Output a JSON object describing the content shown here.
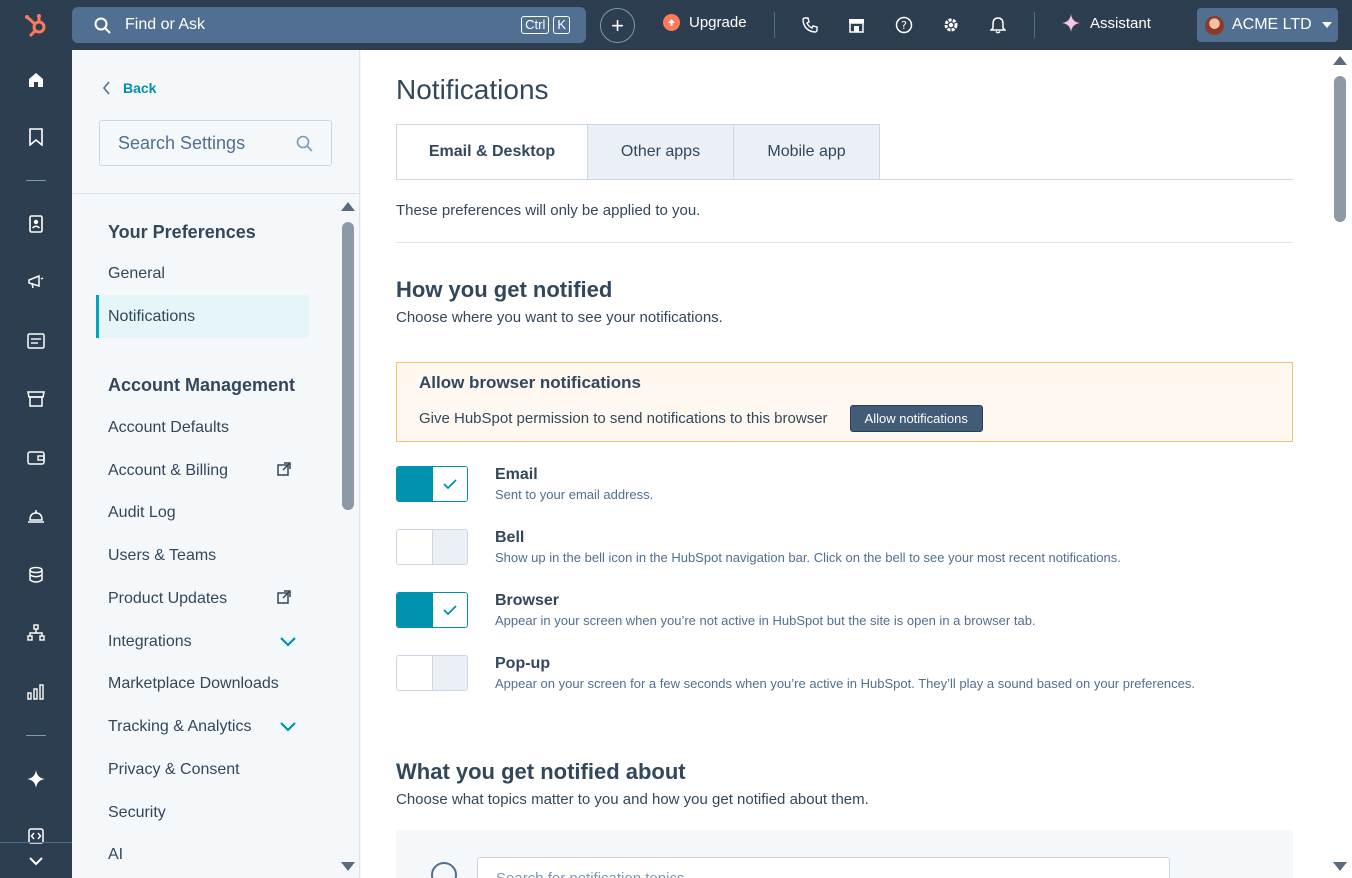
{
  "topbar": {
    "search_placeholder": "Find or Ask",
    "kbd_ctrl": "Ctrl",
    "kbd_k": "K",
    "upgrade_label": "Upgrade",
    "assistant_label": "Assistant",
    "account_name": "ACME LTD"
  },
  "settings_nav": {
    "back_label": "Back",
    "search_placeholder": "Search Settings",
    "section_preferences": "Your Preferences",
    "section_account": "Account Management",
    "items": [
      {
        "label": "General"
      },
      {
        "label": "Notifications"
      },
      {
        "label": "Account Defaults"
      },
      {
        "label": "Account & Billing"
      },
      {
        "label": "Audit Log"
      },
      {
        "label": "Users & Teams"
      },
      {
        "label": "Product Updates"
      },
      {
        "label": "Integrations"
      },
      {
        "label": "Marketplace Downloads"
      },
      {
        "label": "Tracking & Analytics"
      },
      {
        "label": "Privacy & Consent"
      },
      {
        "label": "Security"
      },
      {
        "label": "AI"
      }
    ]
  },
  "main": {
    "title": "Notifications",
    "tabs": [
      {
        "label": "Email & Desktop"
      },
      {
        "label": "Other apps"
      },
      {
        "label": "Mobile app"
      }
    ],
    "intro": "These preferences will only be applied to you.",
    "how_heading": "How you get notified",
    "how_sub": "Choose where you want to see your notifications.",
    "alert": {
      "title": "Allow browser notifications",
      "text": "Give HubSpot permission to send notifications to this browser",
      "button": "Allow notifications"
    },
    "channels": [
      {
        "name": "Email",
        "desc": "Sent to your email address.",
        "enabled": true
      },
      {
        "name": "Bell",
        "desc": "Show up in the bell icon in the HubSpot navigation bar. Click on the bell to see your most recent notifications.",
        "enabled": false
      },
      {
        "name": "Browser",
        "desc": "Appear in your screen when you’re not active in HubSpot but the site is open in a browser tab.",
        "enabled": true
      },
      {
        "name": "Pop-up",
        "desc": "Appear on your screen for a few seconds when you’re active in HubSpot. They’ll play a sound based on your preferences.",
        "enabled": false
      }
    ],
    "what_heading": "What you get notified about",
    "what_sub": "Choose what topics matter to you and how you get notified about them.",
    "topic_search_placeholder": "Search for notification topics"
  },
  "colors": {
    "nav_bg": "#2d3e50",
    "accent": "#0091ae",
    "brand": "#ff7a59"
  }
}
